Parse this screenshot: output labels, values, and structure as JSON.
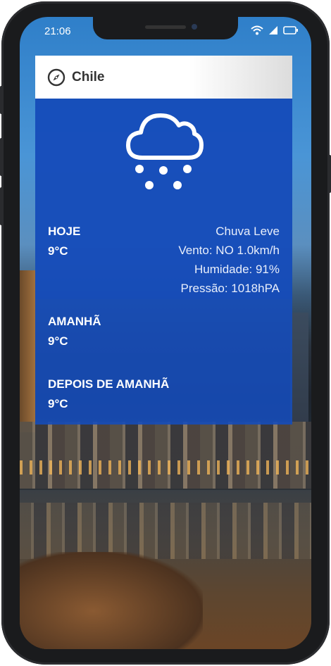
{
  "status_bar": {
    "time": "21:06"
  },
  "app_bar": {
    "icon": "compass-icon",
    "location": "Chile"
  },
  "today": {
    "icon": "cloud-snow-icon",
    "label": "HOJE",
    "temperature": "9°C",
    "condition": "Chuva Leve",
    "wind": "Vento: NO 1.0km/h",
    "humidity": "Humidade: 91%",
    "pressure": "Pressão: 1018hPA"
  },
  "tomorrow": {
    "label": "AMANHÃ",
    "temperature": "9°C"
  },
  "day_after": {
    "label": "DEPOIS DE AMANHÃ",
    "temperature": "9°C"
  },
  "colors": {
    "card_blue": "#164cb9",
    "app_bar_bg": "#ffffff",
    "text_white": "#ffffff"
  }
}
